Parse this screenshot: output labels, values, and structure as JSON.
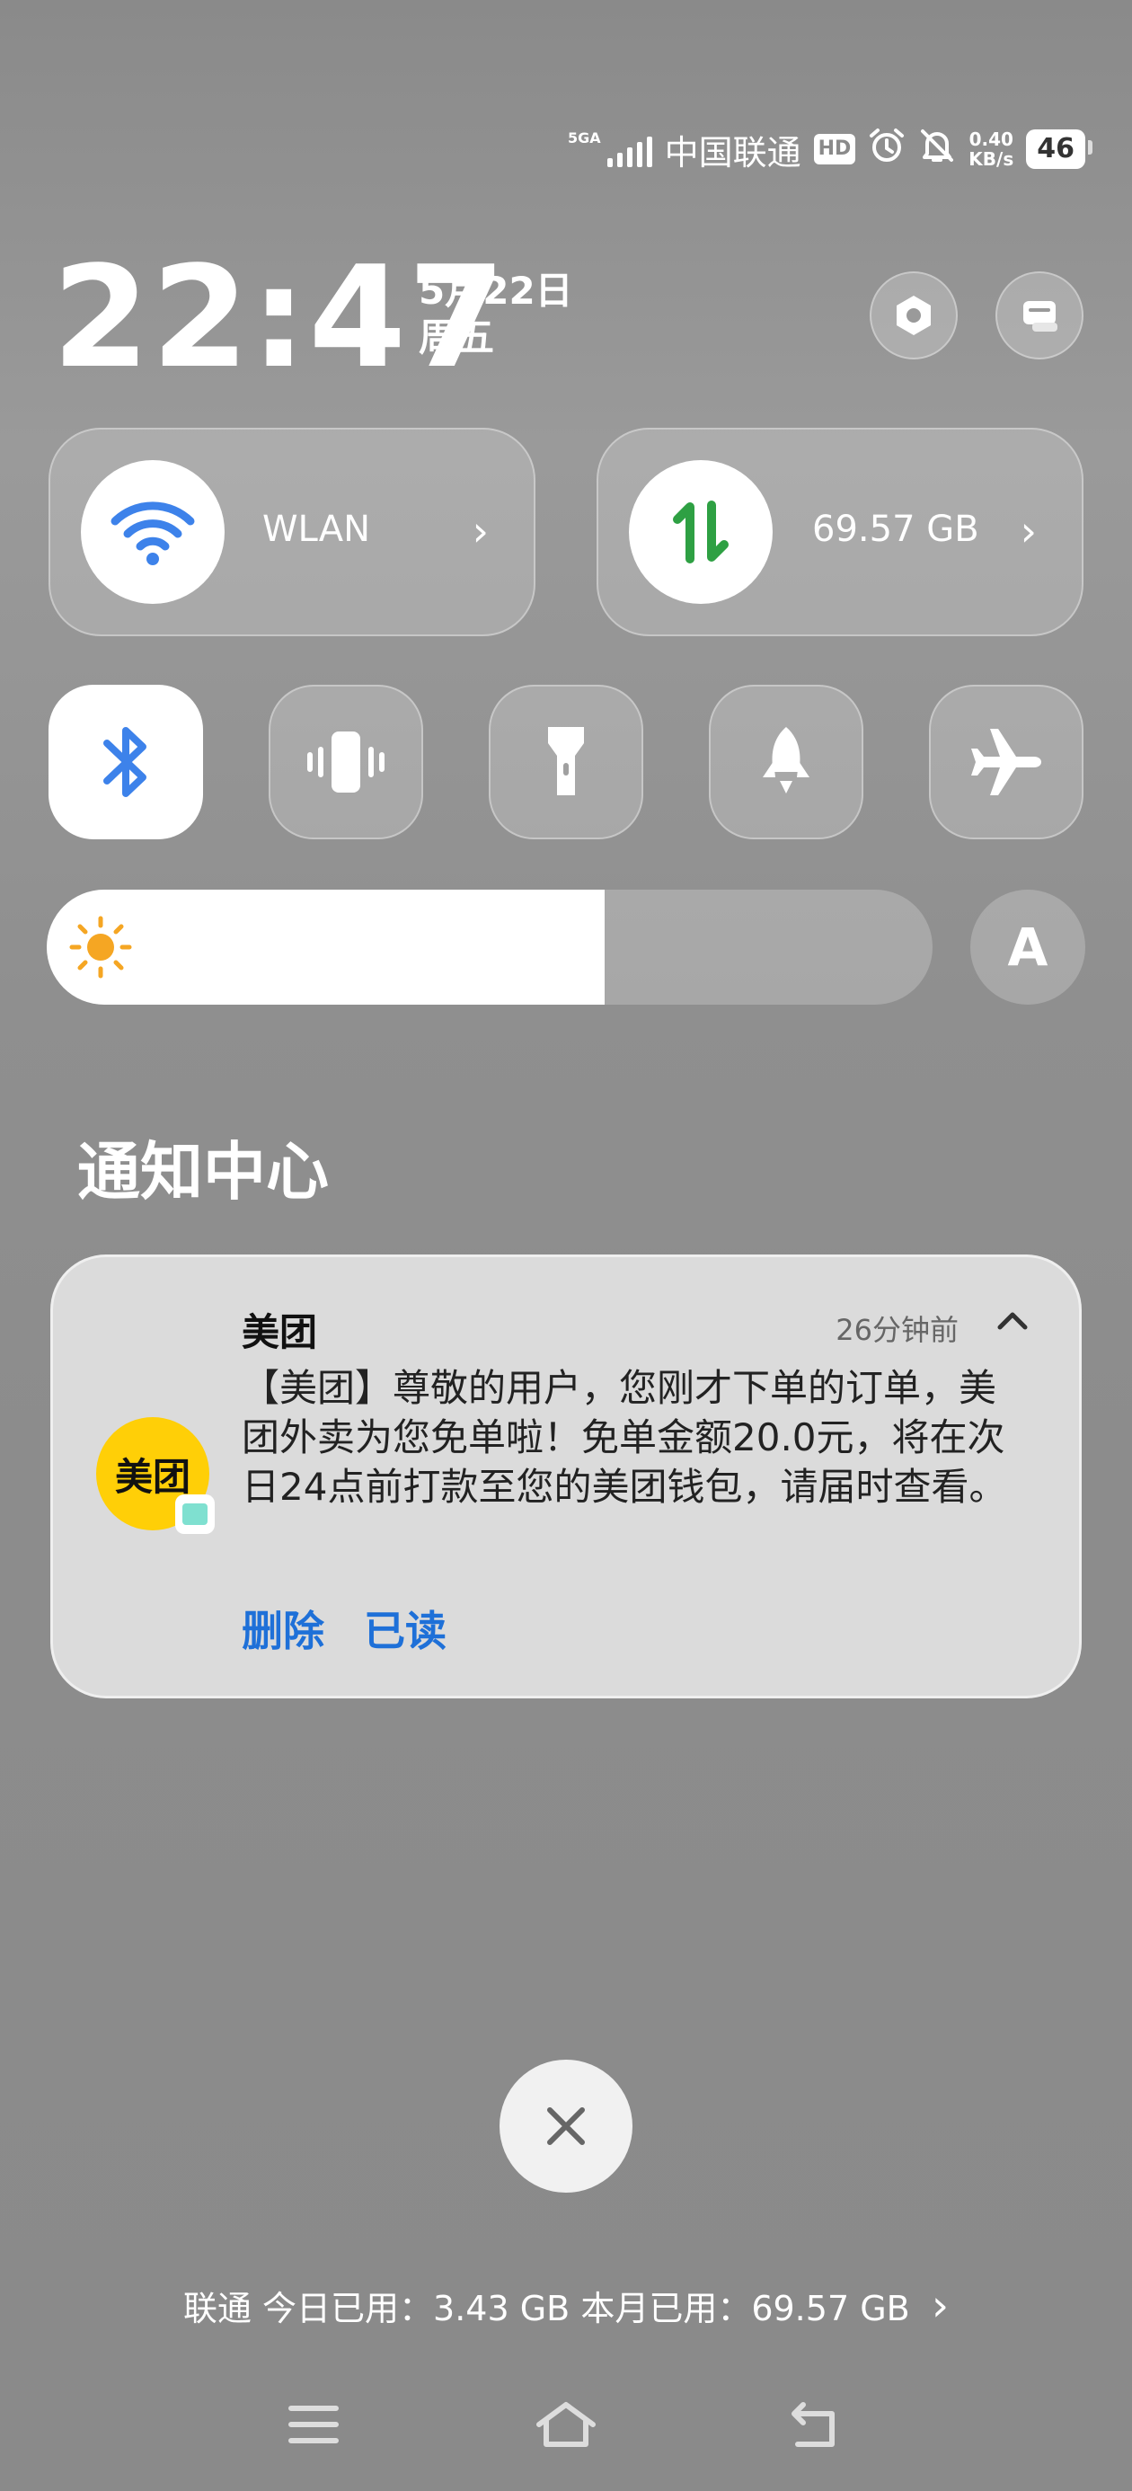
{
  "status_bar": {
    "network_type": "5GA",
    "carrier": "中国联通",
    "hd_badge": "HD",
    "speed_value": "0.40",
    "speed_unit": "KB/s",
    "battery": "46",
    "icons": [
      "signal-icon",
      "alarm-icon",
      "mute-bell-icon"
    ]
  },
  "header": {
    "time": "22:47",
    "date": "5月22日",
    "weekday": "周五",
    "icons": [
      "settings-hexagon-icon",
      "edit-icon"
    ]
  },
  "tiles": {
    "wlan": {
      "label": "WLAN",
      "icon": "wifi-icon",
      "accent": "#3d82ea"
    },
    "data": {
      "label": "69.57 GB",
      "icon": "data-arrows-icon",
      "accent": "#2ea043"
    }
  },
  "toggles": [
    {
      "name": "bluetooth",
      "icon": "bluetooth-icon",
      "on": true
    },
    {
      "name": "vibrate",
      "icon": "vibrate-icon",
      "on": false
    },
    {
      "name": "flashlight",
      "icon": "flashlight-icon",
      "on": false
    },
    {
      "name": "game-mode",
      "icon": "rocket-icon",
      "on": false
    },
    {
      "name": "airplane",
      "icon": "airplane-icon",
      "on": false
    }
  ],
  "brightness": {
    "level": 0.63,
    "auto_label": "A"
  },
  "notification_center": {
    "title": "通知中心",
    "card": {
      "app_logo_text": "美团",
      "app_name": "美团",
      "time_ago": "26分钟前",
      "message": "【美团】尊敬的用户，您刚才下单的订单，美团外卖为您免单啦！免单金额20.0元，将在次日24点前打款至您的美团钱包，请届时查看。",
      "action_delete": "删除",
      "action_read": "已读",
      "accent": "#1e70d8",
      "logo_color": "#ffcf07"
    }
  },
  "usage": {
    "text": "联通 今日已用：3.43 GB  本月已用：69.57 GB"
  },
  "navbar": {
    "icons": [
      "menu-icon",
      "home-icon",
      "back-icon"
    ]
  }
}
